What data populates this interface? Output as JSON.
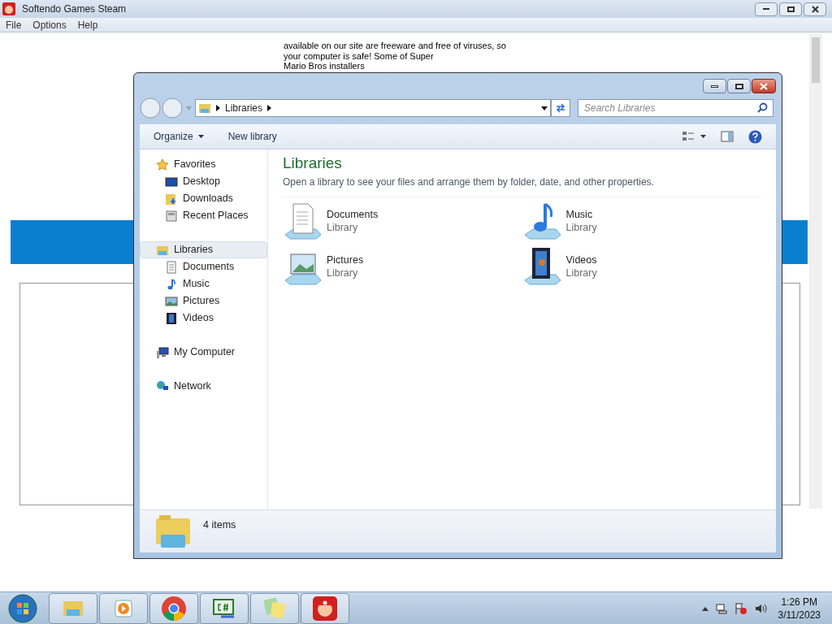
{
  "app": {
    "title": "Softendo Games Steam",
    "menu": [
      "File",
      "Options",
      "Help"
    ],
    "text_lines": [
      "available on our site are freeware and free of viruses, so",
      "your computer is safe! Some of Super",
      "Mario Bros installers"
    ]
  },
  "explorer": {
    "address": [
      "Libraries"
    ],
    "search": {
      "placeholder": "Search Libraries"
    },
    "toolbar": [
      {
        "label": "Organize",
        "kind": "menu"
      },
      {
        "label": "New library",
        "kind": "plain"
      }
    ],
    "nav": [
      {
        "label": "Favorites",
        "kind": "favorites",
        "selected": false,
        "children": [
          {
            "label": "Desktop",
            "kind": "desktop",
            "selected": false
          },
          {
            "label": "Downloads",
            "kind": "downloads",
            "selected": false
          },
          {
            "label": "Recent Places",
            "kind": "recent",
            "selected": false
          }
        ]
      },
      {
        "label": "Libraries",
        "kind": "libraries",
        "selected": true,
        "children": [
          {
            "label": "Documents",
            "kind": "documents",
            "selected": false
          },
          {
            "label": "Music",
            "kind": "music",
            "selected": false
          },
          {
            "label": "Pictures",
            "kind": "pictures",
            "selected": false
          },
          {
            "label": "Videos",
            "kind": "videos",
            "selected": false
          }
        ]
      },
      {
        "label": "My Computer",
        "kind": "computer",
        "selected": false
      },
      {
        "label": "Network",
        "kind": "network",
        "selected": false
      }
    ],
    "heading": "Libraries",
    "subtitle": "Open a library to see your files and arrange them by folder, date, and other properties.",
    "items": [
      {
        "name": "Documents",
        "type": "Library",
        "kind": "documents"
      },
      {
        "name": "Music",
        "type": "Library",
        "kind": "music"
      },
      {
        "name": "Pictures",
        "type": "Library",
        "kind": "pictures"
      },
      {
        "name": "Videos",
        "type": "Library",
        "kind": "videos"
      }
    ],
    "status": "4 items"
  },
  "taskbar": {
    "apps": [
      {
        "kind": "explorer"
      },
      {
        "kind": "media"
      },
      {
        "kind": "browser"
      },
      {
        "kind": "code"
      },
      {
        "kind": "notes"
      },
      {
        "kind": "game"
      }
    ],
    "time": "1:26 PM",
    "date": "3/11/2023"
  }
}
